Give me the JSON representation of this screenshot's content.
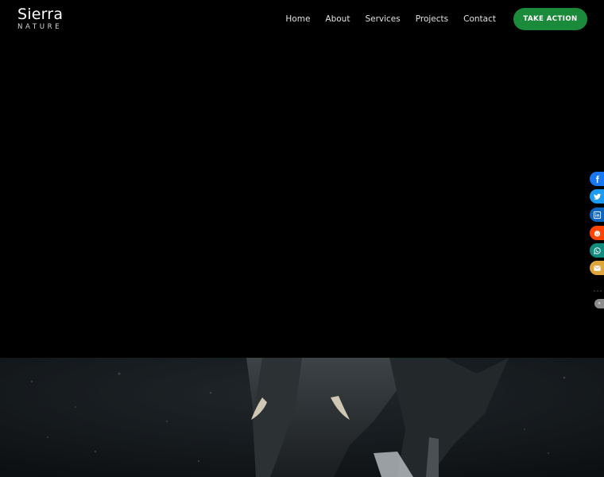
{
  "brand": {
    "name": "Sierra",
    "tagline": "NATURE"
  },
  "nav": {
    "items": [
      {
        "label": "Home"
      },
      {
        "label": "About"
      },
      {
        "label": "Services"
      },
      {
        "label": "Projects"
      },
      {
        "label": "Contact"
      }
    ]
  },
  "cta": {
    "label": "TAKE ACTION",
    "color": "#1b8a3a"
  },
  "share": {
    "buttons": [
      {
        "icon": "facebook-icon",
        "color": "#1877f2"
      },
      {
        "icon": "twitter-icon",
        "color": "#1d9bf0"
      },
      {
        "icon": "linkedin-icon",
        "color": "#0a66c2"
      },
      {
        "icon": "reddit-icon",
        "color": "#ff4500"
      },
      {
        "icon": "whatsapp-icon",
        "color": "#128c7e"
      },
      {
        "icon": "email-icon",
        "color": "#e0a63e"
      }
    ],
    "more_icon": "more-dots-icon",
    "toggle_label": "»"
  },
  "hero": {
    "image": "elephant-hero-image"
  }
}
